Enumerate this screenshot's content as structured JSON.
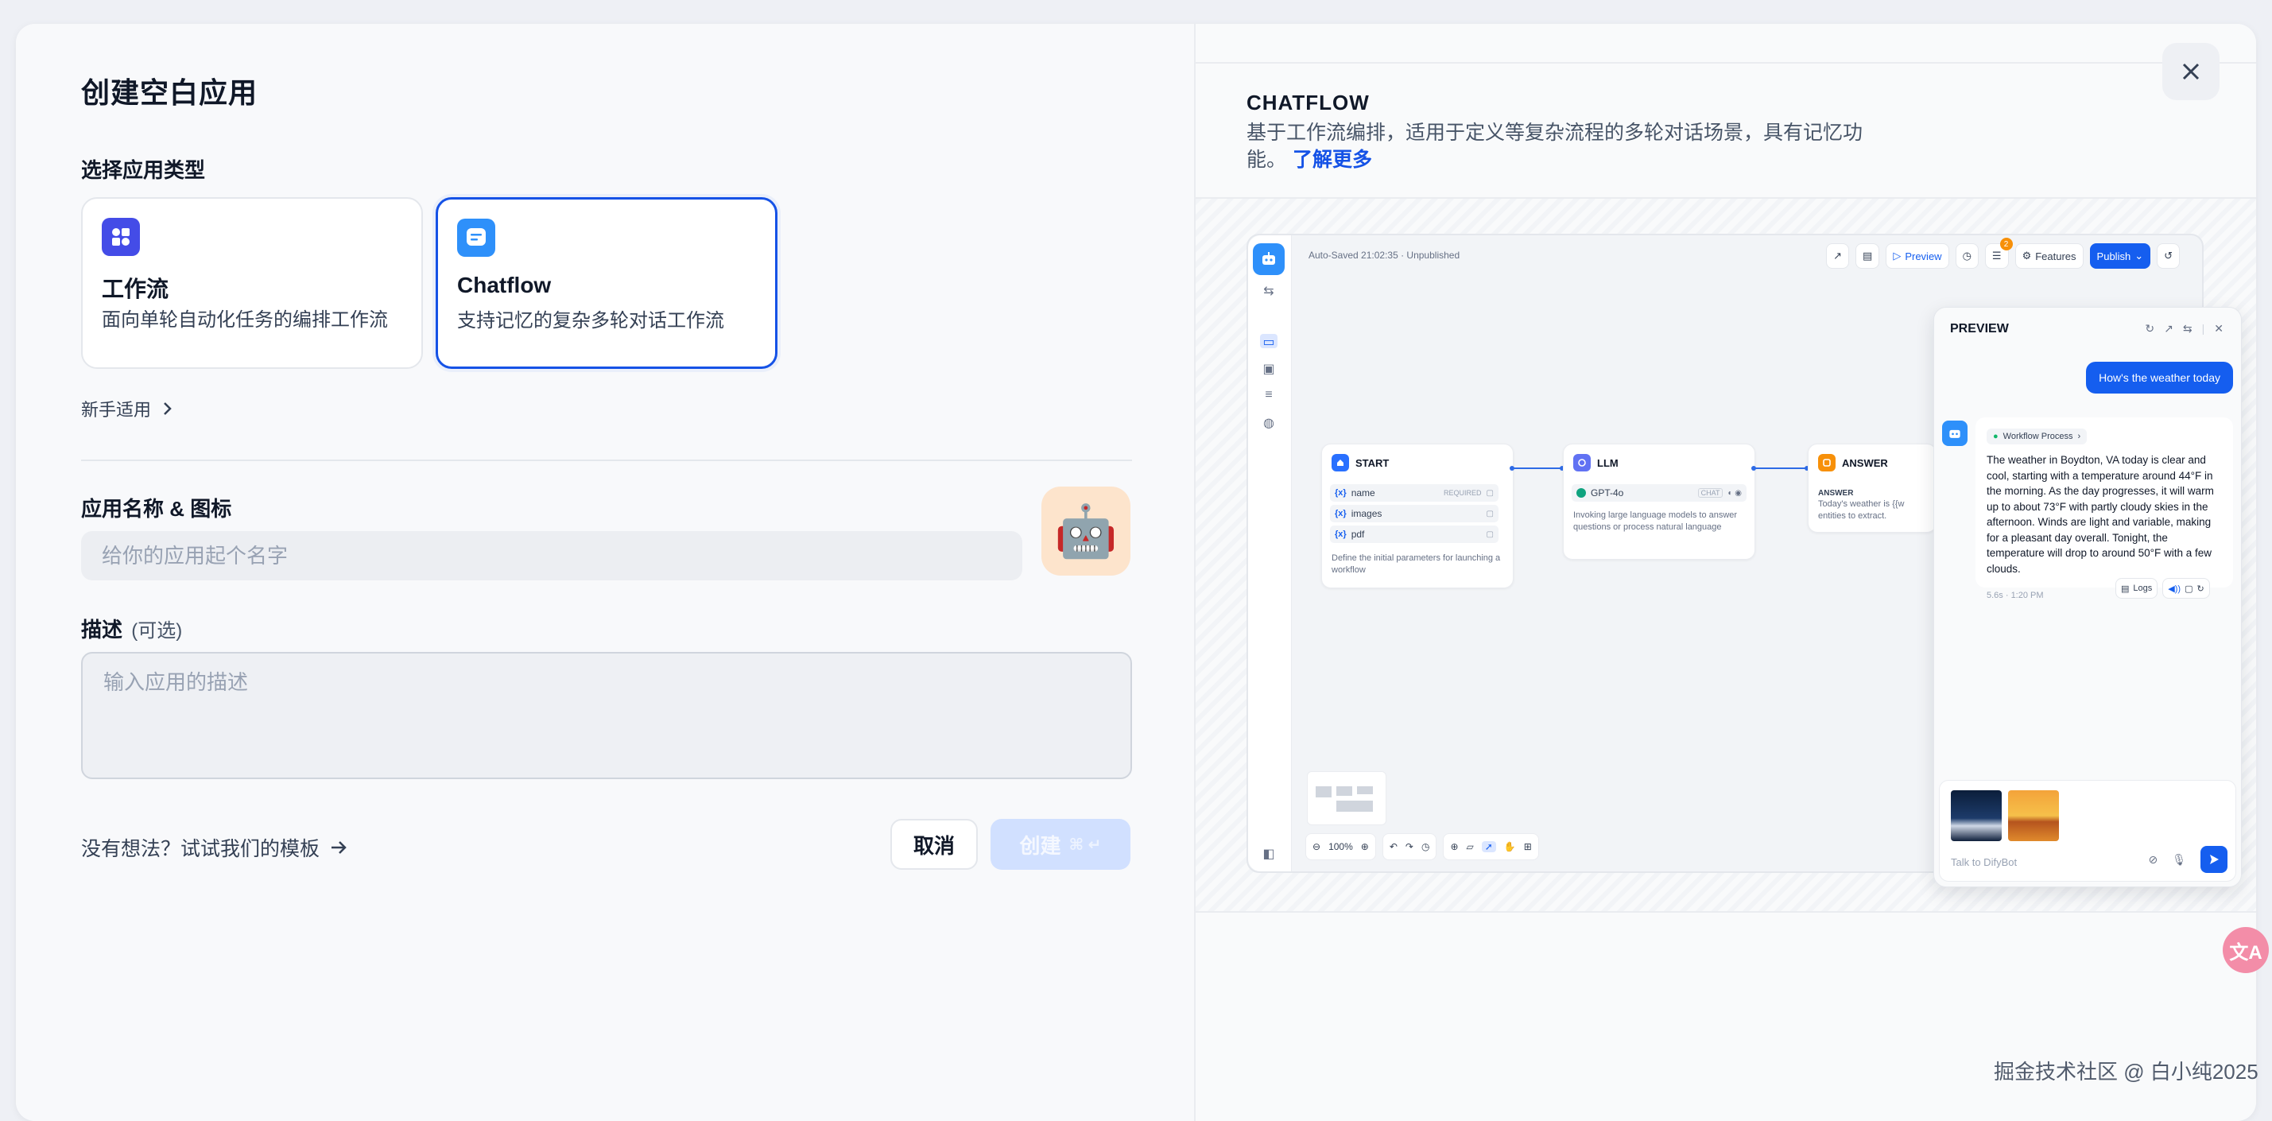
{
  "dialog": {
    "title": "创建空白应用",
    "app_type_label": "选择应用类型",
    "cards": [
      {
        "name": "工作流",
        "desc": "面向单轮自动化任务的编排工作流",
        "selected": false,
        "icon_color": "#444ce7"
      },
      {
        "name": "Chatflow",
        "desc": "支持记忆的复杂多轮对话工作流",
        "selected": true,
        "icon_color": "#2e90fa"
      }
    ],
    "beginner_link": "新手适用",
    "name_icon_label": "应用名称 & 图标",
    "name_placeholder": "给你的应用起个名字",
    "avatar_emoji": "🤖",
    "desc_label": "描述",
    "desc_optional": "(可选)",
    "desc_placeholder": "输入应用的描述",
    "template_link": "没有想法？试试我们的模板",
    "cancel_label": "取消",
    "create_label": "创建",
    "create_shortcut": "⌘ ↵"
  },
  "preview_info": {
    "title": "CHATFLOW",
    "desc": "基于工作流编排，适用于定义等复杂流程的多轮对话场景，具有记忆功能。",
    "learn_more": "了解更多"
  },
  "workflow": {
    "autosave": "Auto-Saved 21:02:35 · Unpublished",
    "toolbar": {
      "preview": "Preview",
      "features": "Features",
      "publish": "Publish",
      "badge": "2"
    },
    "start": {
      "title": "START",
      "vars": [
        {
          "name": "name",
          "tag": "REQUIRED"
        },
        {
          "name": "images",
          "tag": ""
        },
        {
          "name": "pdf",
          "tag": ""
        }
      ],
      "desc": "Define the initial parameters for launching a workflow"
    },
    "llm": {
      "title": "LLM",
      "model": "GPT-4o",
      "mode": "CHAT",
      "desc": "Invoking large language models to answer questions or process natural language"
    },
    "answer": {
      "title": "ANSWER",
      "label": "ANSWER",
      "text": "Today's weather is {{w",
      "text2": "entities to extract."
    },
    "zoom": "100%"
  },
  "preview_panel": {
    "title": "PREVIEW",
    "user_msg": "How's the weather today",
    "process_label": "Workflow Process",
    "bot_msg": "The weather in Boydton, VA today is clear and cool, starting with a temperature around 44°F in the morning. As the day progresses, it will warm up to about 73°F with partly cloudy skies in the afternoon. Winds are light and variable, making for a pleasant day overall. Tonight, the temperature will drop to around 50°F with a few clouds.",
    "meta": "5.6s · 1:20 PM",
    "logs_label": "Logs",
    "input_placeholder": "Talk to DifyBot"
  },
  "translate_icon": "文A",
  "watermark": "掘金技术社区 @ 白小纯2025"
}
